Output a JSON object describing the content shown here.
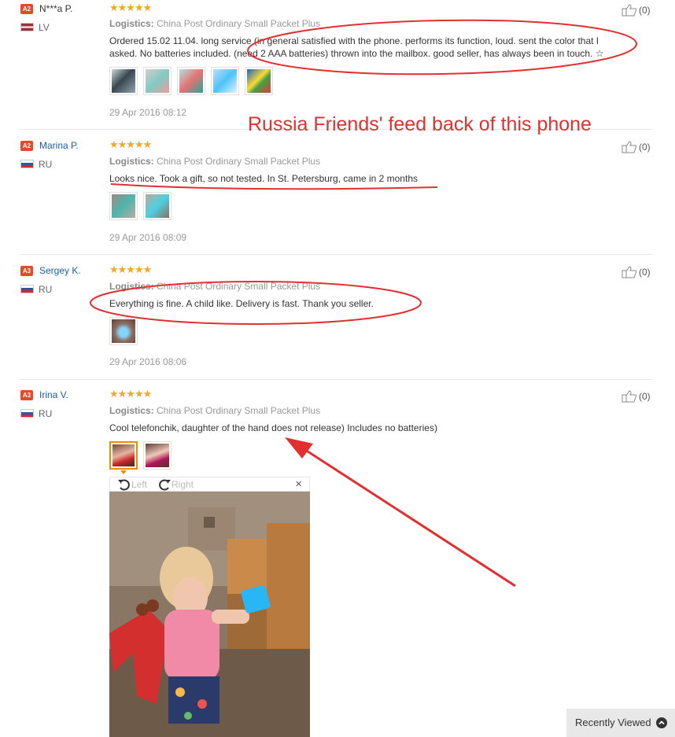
{
  "reviews": [
    {
      "level": "A2",
      "name": "N***a P.",
      "country": "LV",
      "flag": "lv",
      "stars": "★★★★★",
      "logistics_label": "Logistics:",
      "logistics": "China Post Ordinary Small Packet Plus",
      "text_line1": "Ordered 15.02 11.04. long service (in general satisfied with the phone. performs its function, loud. sent the color that I",
      "text_line2": "asked. No batteries included. (need 2 AAA batteries) thrown into the mailbox. good seller, has always been in touch. ☆",
      "date": "29 Apr 2016 08:12",
      "likes": "(0)"
    },
    {
      "level": "A2",
      "name": "Marina P.",
      "country": "RU",
      "flag": "ru",
      "stars": "★★★★★",
      "logistics_label": "Logistics:",
      "logistics": "China Post Ordinary Small Packet Plus",
      "text_line1": "Looks nice. Took a gift, so not tested. In St. Petersburg, came in 2 months",
      "date": "29 Apr 2016 08:09",
      "likes": "(0)"
    },
    {
      "level": "A3",
      "name": "Sergey K.",
      "country": "RU",
      "flag": "ru",
      "stars": "★★★★★",
      "logistics_label": "Logistics:",
      "logistics": "China Post Ordinary Small Packet Plus",
      "text_line1": "Everything is fine. A child like. Delivery is fast. Thank you seller.",
      "date": "29 Apr 2016 08:06",
      "likes": "(0)"
    },
    {
      "level": "A3",
      "name": "Irina V.",
      "country": "RU",
      "flag": "ru",
      "stars": "★★★★★",
      "logistics_label": "Logistics:",
      "logistics": "China Post Ordinary Small Packet Plus",
      "text_line1": "Cool telefonchik, daughter of the hand does not release) Includes no batteries)",
      "likes": "(0)"
    }
  ],
  "annotation": "Russia Friends' feed back of this phone",
  "viewer": {
    "rotate_left": "Left",
    "rotate_right": "Right",
    "close": "×"
  },
  "recently_viewed": "Recently Viewed",
  "colors": {
    "accent_red": "#e03030",
    "stars": "#f6a623",
    "name_link": "#1a5fa8"
  }
}
